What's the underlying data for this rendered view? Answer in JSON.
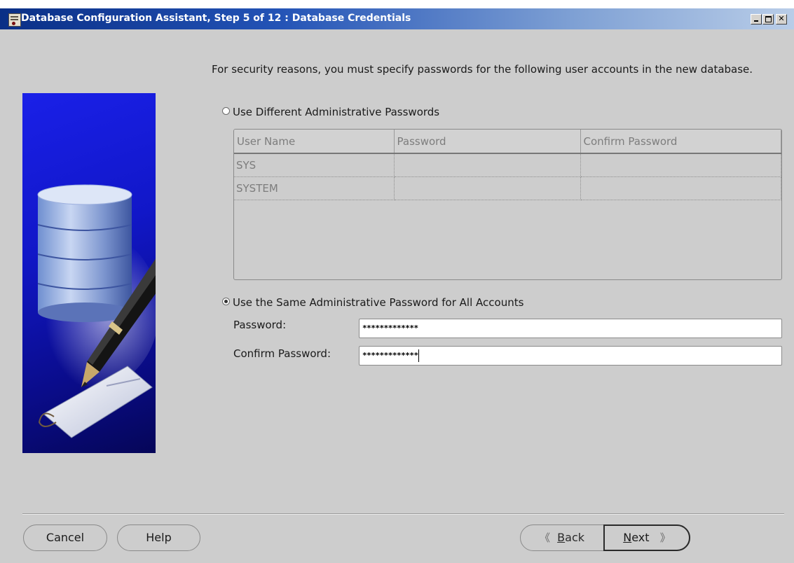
{
  "window": {
    "title": "Database Configuration Assistant, Step 5 of 12 : Database Credentials"
  },
  "intro_text": "For security reasons, you must specify passwords for the following user accounts in the new database.",
  "options": {
    "different_label": "Use Different Administrative Passwords",
    "same_label": "Use the Same Administrative Password for All Accounts",
    "selected": "same"
  },
  "table": {
    "headers": [
      "User Name",
      "Password",
      "Confirm Password"
    ],
    "rows": [
      [
        "SYS",
        "",
        ""
      ],
      [
        "SYSTEM",
        "",
        ""
      ]
    ]
  },
  "form": {
    "password_label": "Password:",
    "password_value": "*************",
    "confirm_label": "Confirm Password:",
    "confirm_value": "*************"
  },
  "buttons": {
    "cancel": "Cancel",
    "help": "Help",
    "back_prefix": "",
    "back_mnemonic": "B",
    "back_rest": "ack",
    "next_mnemonic": "N",
    "next_rest": "ext"
  },
  "icons": {
    "back": "chevron-left-icon",
    "next": "chevron-right-icon",
    "app": "database-app-icon"
  }
}
